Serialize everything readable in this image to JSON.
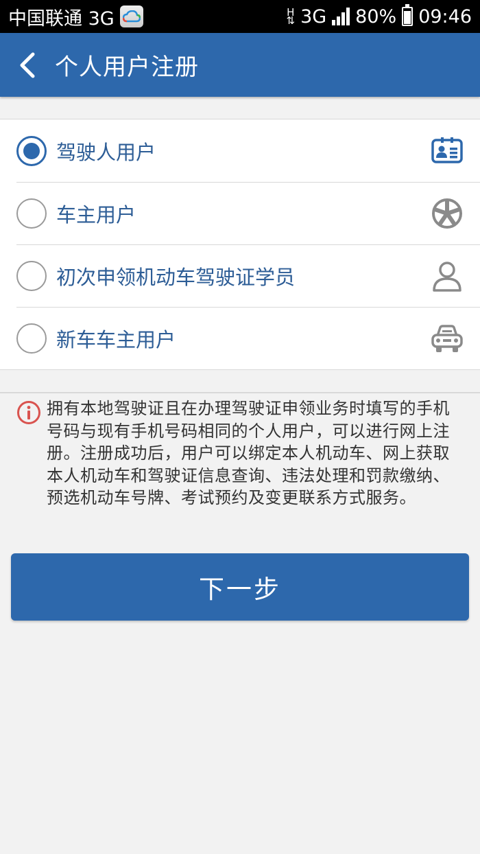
{
  "status_bar": {
    "carrier": "中国联通 3G",
    "network_h": "H",
    "network_type": "3G",
    "battery": "80%",
    "time": "09:46"
  },
  "app_bar": {
    "back_icon": "chevron-left-icon",
    "title": "个人用户注册"
  },
  "options": [
    {
      "label": "驾驶人用户",
      "selected": true,
      "icon": "id-card-icon"
    },
    {
      "label": "车主用户",
      "selected": false,
      "icon": "wheel-icon"
    },
    {
      "label": "初次申领机动车驾驶证学员",
      "selected": false,
      "icon": "person-icon"
    },
    {
      "label": "新车车主用户",
      "selected": false,
      "icon": "car-icon"
    }
  ],
  "notice": {
    "icon": "info-icon",
    "text": "拥有本地驾驶证且在办理驾驶证申领业务时填写的手机号码与现有手机号码相同的个人用户，可以进行网上注册。注册成功后，用户可以绑定本人机动车、网上获取本人机动车和驾驶证信息查询、违法处理和罚款缴纳、预选机动车号牌、考试预约及变更联系方式服务。"
  },
  "next_button": {
    "label": "下一步"
  },
  "colors": {
    "primary": "#2d68ac",
    "label": "#2d5d96",
    "warning": "#d9534f"
  }
}
